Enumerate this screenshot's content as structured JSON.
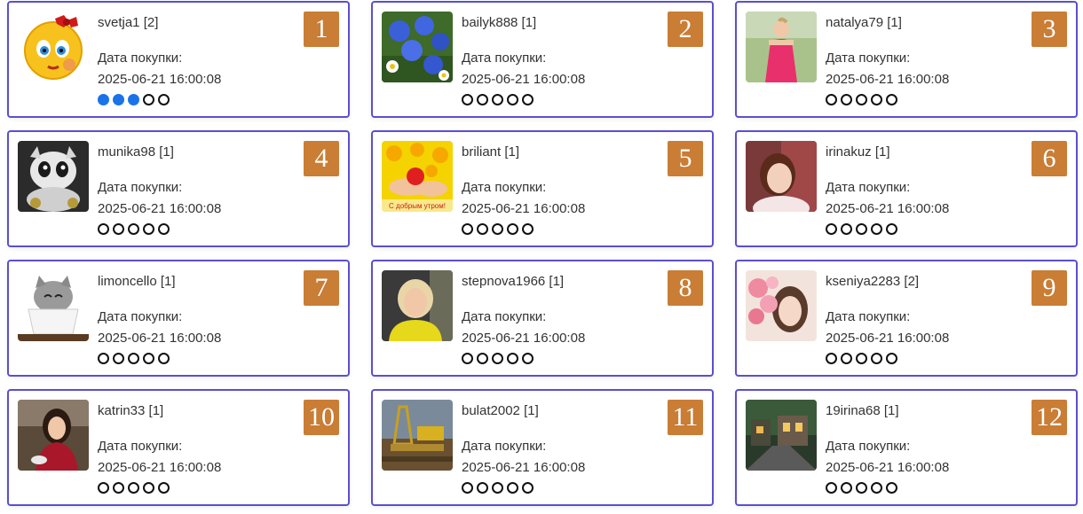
{
  "date_label": "Дата покупки:",
  "dot_colors": {
    "filled": "#1a73e8",
    "empty_border": "#111111"
  },
  "rank_color": "#c97d35",
  "border_color": "#5a4fd0",
  "cards": [
    {
      "rank": "1",
      "username": "svetja1 [2]",
      "date": "2025-06-21 16:00:08",
      "rating": 3,
      "avatar": "emoji-girl-face"
    },
    {
      "rank": "2",
      "username": "bailyk888 [1]",
      "date": "2025-06-21 16:00:08",
      "rating": 0,
      "avatar": "cornflowers-photo"
    },
    {
      "rank": "3",
      "username": "natalya79 [1]",
      "date": "2025-06-21 16:00:08",
      "rating": 0,
      "avatar": "woman-pink-dress-photo"
    },
    {
      "rank": "4",
      "username": "munika98 [1]",
      "date": "2025-06-21 16:00:08",
      "rating": 0,
      "avatar": "white-dragon-photo"
    },
    {
      "rank": "5",
      "username": "briliant [1]",
      "date": "2025-06-21 16:00:08",
      "rating": 0,
      "avatar": "good-morning-card"
    },
    {
      "rank": "6",
      "username": "irinakuz [1]",
      "date": "2025-06-21 16:00:08",
      "rating": 0,
      "avatar": "woman-portrait-photo"
    },
    {
      "rank": "7",
      "username": "limoncello [1]",
      "date": "2025-06-21 16:00:08",
      "rating": 0,
      "avatar": "cat-in-cup-photo"
    },
    {
      "rank": "8",
      "username": "stepnova1966 [1]",
      "date": "2025-06-21 16:00:08",
      "rating": 0,
      "avatar": "blonde-woman-photo"
    },
    {
      "rank": "9",
      "username": "kseniya2283 [2]",
      "date": "2025-06-21 16:00:08",
      "rating": 0,
      "avatar": "girl-with-flowers-photo"
    },
    {
      "rank": "10",
      "username": "katrin33 [1]",
      "date": "2025-06-21 16:00:08",
      "rating": 0,
      "avatar": "woman-at-cafe-photo"
    },
    {
      "rank": "11",
      "username": "bulat2002 [1]",
      "date": "2025-06-21 16:00:08",
      "rating": 0,
      "avatar": "oil-rig-photo"
    },
    {
      "rank": "12",
      "username": "19irina68 [1]",
      "date": "2025-06-21 16:00:08",
      "rating": 0,
      "avatar": "street-night-photo"
    }
  ],
  "good_morning_text": "С добрым утром!"
}
